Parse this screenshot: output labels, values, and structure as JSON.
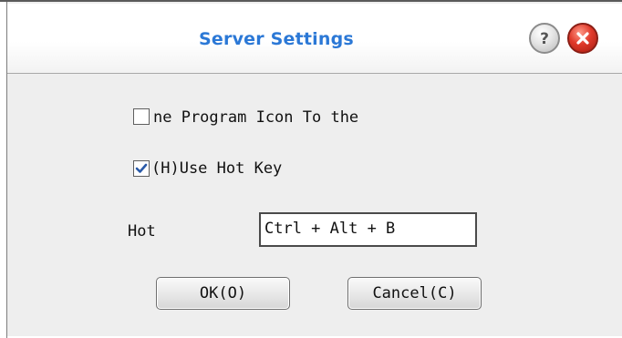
{
  "window": {
    "title": "Server Settings",
    "help_icon": "question-mark-icon",
    "close_icon": "close-x-icon"
  },
  "options": {
    "program_icon_label": "ne Program Icon To the",
    "program_icon_checked": false,
    "hotkey_label": "(H)Use Hot Key",
    "hotkey_checked": true
  },
  "hotkey": {
    "label": "Hot",
    "value": "Ctrl + Alt + B"
  },
  "buttons": {
    "ok_label": "OK(O)",
    "cancel_label": "Cancel(C)"
  },
  "colors": {
    "title_text": "#2b78d6",
    "close_button": "#e0392a",
    "dialog_background": "#eeeeee",
    "checkmark": "#2a5aa8"
  }
}
